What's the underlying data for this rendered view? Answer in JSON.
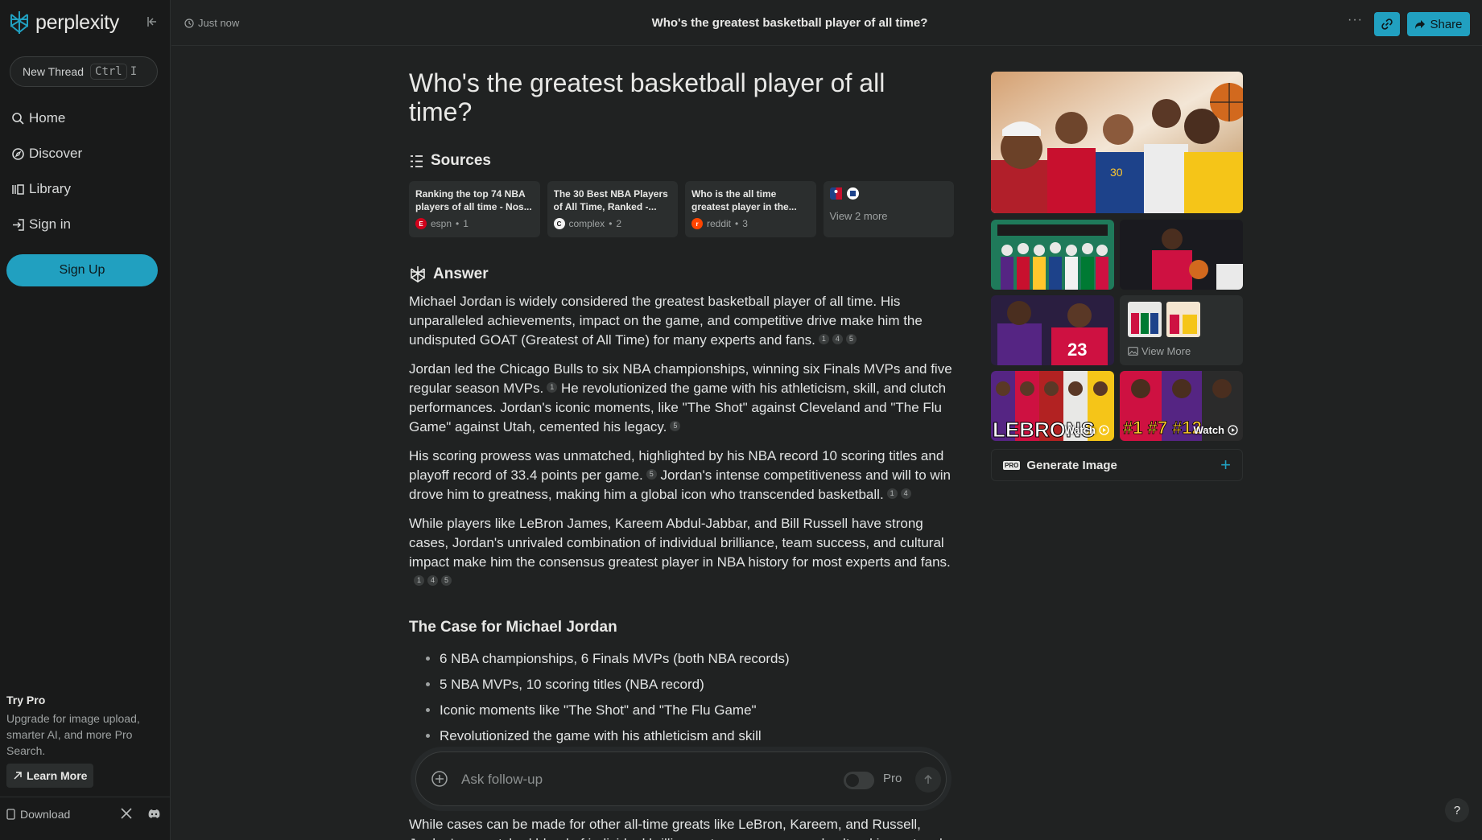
{
  "app": {
    "name": "perplexity"
  },
  "sidebar": {
    "new_thread": "New Thread",
    "shortcut_key1": "Ctrl",
    "shortcut_key2": "I",
    "nav": [
      {
        "label": "Home",
        "icon": "search-icon"
      },
      {
        "label": "Discover",
        "icon": "compass-icon"
      },
      {
        "label": "Library",
        "icon": "library-icon"
      },
      {
        "label": "Sign in",
        "icon": "sign-in-icon"
      }
    ],
    "signup": "Sign Up",
    "try_pro_title": "Try Pro",
    "try_pro_desc": "Upgrade for image upload, smarter AI, and more Pro Search.",
    "learn_more": "Learn More",
    "download": "Download"
  },
  "topbar": {
    "time": "Just now",
    "title": "Who's the greatest basketball player of all time?",
    "more": "···",
    "share": "Share"
  },
  "main": {
    "question": "Who's the greatest basketball player of all time?",
    "sources_heading": "Sources",
    "sources": [
      {
        "title": "Ranking the top 74 NBA players of all time - Nos...",
        "site": "espn",
        "num": "1",
        "color": "#d0021b",
        "letter": "E"
      },
      {
        "title": "The 30 Best NBA Players of All Time, Ranked -...",
        "site": "complex",
        "num": "2",
        "color": "#f2f2f2",
        "letter": "C"
      },
      {
        "title": "Who is the all time greatest player in the...",
        "site": "reddit",
        "num": "3",
        "color": "#ff4500",
        "letter": "r"
      }
    ],
    "view_more_sources": "View 2 more",
    "answer_heading": "Answer",
    "p1": "Michael Jordan is widely considered the greatest basketball player of all time. His unparalleled achievements, impact on the game, and competitive drive make him the undisputed GOAT (Greatest of All Time) for many experts and fans.",
    "p2a": "Jordan led the Chicago Bulls to six NBA championships, winning six Finals MVPs and five regular season MVPs.",
    "p2b": "He revolutionized the game with his athleticism, skill, and clutch performances. Jordan's iconic moments, like \"The Shot\" against Cleveland and \"The Flu Game\" against Utah, cemented his legacy.",
    "p3a": "His scoring prowess was unmatched, highlighted by his NBA record 10 scoring titles and playoff record of 33.4 points per game.",
    "p3b": "Jordan's intense competitiveness and will to win drove him to greatness, making him a global icon who transcended basketball.",
    "p4": "While players like LeBron James, Kareem Abdul-Jabbar, and Bill Russell have strong cases, Jordan's unrivaled combination of individual brilliance, team success, and cultural impact make him the consensus greatest player in NBA history for most experts and fans.",
    "cites": {
      "c1": "1",
      "c4": "4",
      "c5": "5"
    },
    "case_heading": "The Case for Michael Jordan",
    "bullets": [
      "6 NBA championships, 6 Finals MVPs (both NBA records)",
      "5 NBA MVPs, 10 scoring titles (NBA record)",
      "Iconic moments like \"The Shot\" and \"The Flu Game\"",
      "Revolutionized the game with his athleticism and skill"
    ],
    "tail": "While cases can be made for other all-time greats like LeBron, Kareem, and Russell, Jordan's unmatched blend of individual brilliance, team success, and cultural impact make"
  },
  "followup": {
    "placeholder": "Ask follow-up",
    "pro_label": "Pro"
  },
  "media": {
    "view_more": "View More",
    "watch": "Watch",
    "video1_overlay": "LEBRONS",
    "video2_overlay": "#1  #7  #12",
    "generate_image": "Generate Image",
    "pro_tag": "PRO"
  },
  "colors": {
    "accent": "#21a0c0",
    "background": "#202222",
    "sidebar": "#191a1a",
    "card": "#2b2e2e"
  }
}
